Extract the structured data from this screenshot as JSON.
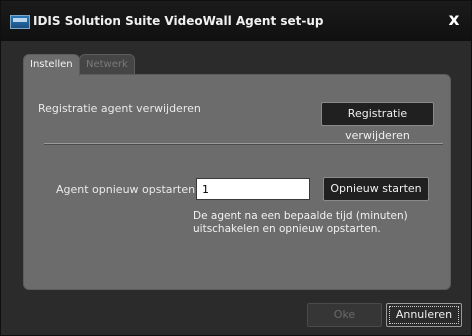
{
  "window": {
    "title": "IDIS Solution Suite VideoWall Agent set-up",
    "close_glyph": "x"
  },
  "tabs": [
    {
      "label": "Instellen",
      "active": true
    },
    {
      "label": "Netwerk",
      "active": false
    }
  ],
  "unregister": {
    "label": "Registratie agent verwijderen",
    "button": "Registratie verwijderen"
  },
  "restart": {
    "label": "Agent opnieuw opstarten :",
    "value": "1",
    "button": "Opnieuw starten",
    "hint": "De agent na een bepaalde tijd (minuten) uitschakelen en opnieuw opstarten."
  },
  "footer": {
    "ok": "Oke",
    "cancel": "Annuleren"
  },
  "colors": {
    "panel": "#6c6c6c",
    "background": "#2b2b2b",
    "button": "#202020"
  },
  "icons": {
    "app": "monitor-icon",
    "close": "close-icon"
  }
}
